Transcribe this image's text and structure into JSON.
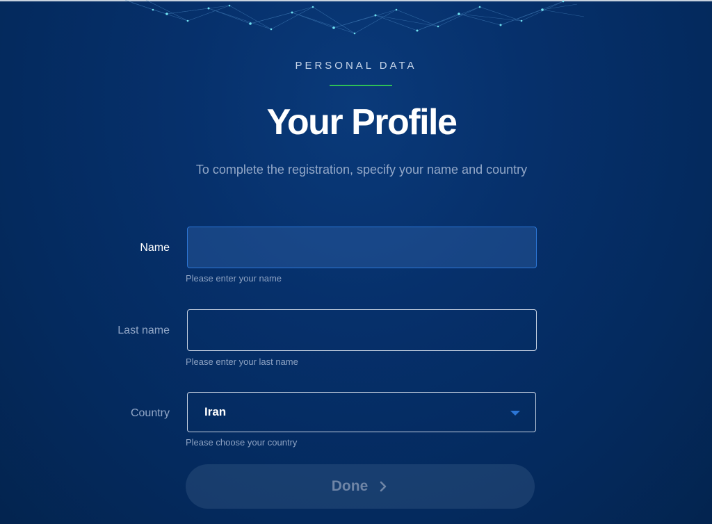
{
  "header": {
    "eyebrow": "PERSONAL DATA",
    "title": "Your Profile",
    "subtitle": "To complete the registration, specify your name and country"
  },
  "form": {
    "name": {
      "label": "Name",
      "value": "",
      "hint": "Please enter your name"
    },
    "last_name": {
      "label": "Last name",
      "value": "",
      "hint": "Please enter your last name"
    },
    "country": {
      "label": "Country",
      "selected": "Iran",
      "hint": "Please choose your country"
    },
    "submit_label": "Done"
  },
  "icons": {
    "dropdown": "chevron-down-icon",
    "submit": "chevron-right-icon"
  },
  "colors": {
    "background": "#04306a",
    "accent_green": "#2fbf56",
    "accent_blue": "#2c76d6",
    "muted_text": "#93a8c8"
  }
}
